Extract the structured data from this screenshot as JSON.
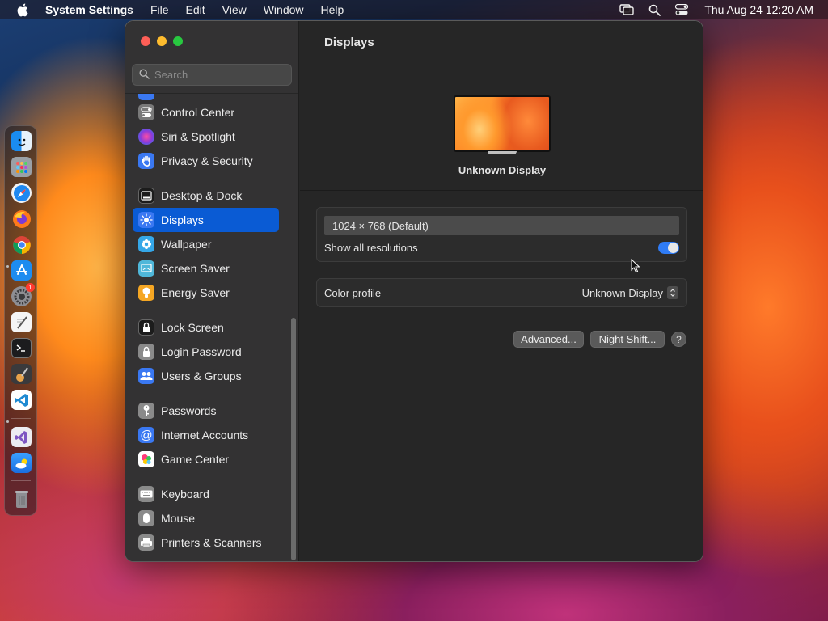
{
  "menubar": {
    "app_name": "System Settings",
    "menus": [
      "File",
      "Edit",
      "View",
      "Window",
      "Help"
    ],
    "clock": "Thu Aug 24  12:20 AM"
  },
  "dock": {
    "badge_count": "1"
  },
  "window": {
    "search": {
      "placeholder": "Search"
    },
    "sidebar": {
      "items": [
        {
          "label": "Control Center",
          "icon": "control-center-icon",
          "color": "#7a7a7a"
        },
        {
          "label": "Siri & Spotlight",
          "icon": "siri-icon",
          "color": "#c23bd4"
        },
        {
          "label": "Privacy & Security",
          "icon": "hand-icon",
          "color": "#3a78f2"
        },
        {
          "label": "Desktop & Dock",
          "icon": "desktop-dock-icon",
          "color": "#1c1c1c"
        },
        {
          "label": "Displays",
          "icon": "sun-icon",
          "color": "#3a78f2",
          "selected": true
        },
        {
          "label": "Wallpaper",
          "icon": "flower-icon",
          "color": "#35a7e8"
        },
        {
          "label": "Screen Saver",
          "icon": "screen-saver-icon",
          "color": "#4fb7d9"
        },
        {
          "label": "Energy Saver",
          "icon": "bulb-icon",
          "color": "#f5a623"
        },
        {
          "label": "Lock Screen",
          "icon": "lock-icon",
          "color": "#1c1c1c"
        },
        {
          "label": "Login Password",
          "icon": "padlock-icon",
          "color": "#8a8a8a"
        },
        {
          "label": "Users & Groups",
          "icon": "users-icon",
          "color": "#3a78f2"
        },
        {
          "label": "Passwords",
          "icon": "key-icon",
          "color": "#8a8a8a"
        },
        {
          "label": "Internet Accounts",
          "icon": "at-icon",
          "color": "#3a78f2"
        },
        {
          "label": "Game Center",
          "icon": "game-center-icon",
          "color": "#ffffff"
        },
        {
          "label": "Keyboard",
          "icon": "keyboard-icon",
          "color": "#8a8a8a"
        },
        {
          "label": "Mouse",
          "icon": "mouse-icon",
          "color": "#8a8a8a"
        },
        {
          "label": "Printers & Scanners",
          "icon": "printer-icon",
          "color": "#8a8a8a"
        }
      ]
    },
    "content": {
      "title": "Displays",
      "display_name": "Unknown Display",
      "resolution": "1024 × 768 (Default)",
      "show_all_label": "Show all resolutions",
      "show_all_on": true,
      "color_profile_label": "Color profile",
      "color_profile_value": "Unknown Display",
      "advanced_button": "Advanced...",
      "night_shift_button": "Night Shift...",
      "help_button": "?"
    }
  },
  "colors": {
    "accent": "#0a5bd4",
    "toggle_on": "#2f7cf6"
  }
}
